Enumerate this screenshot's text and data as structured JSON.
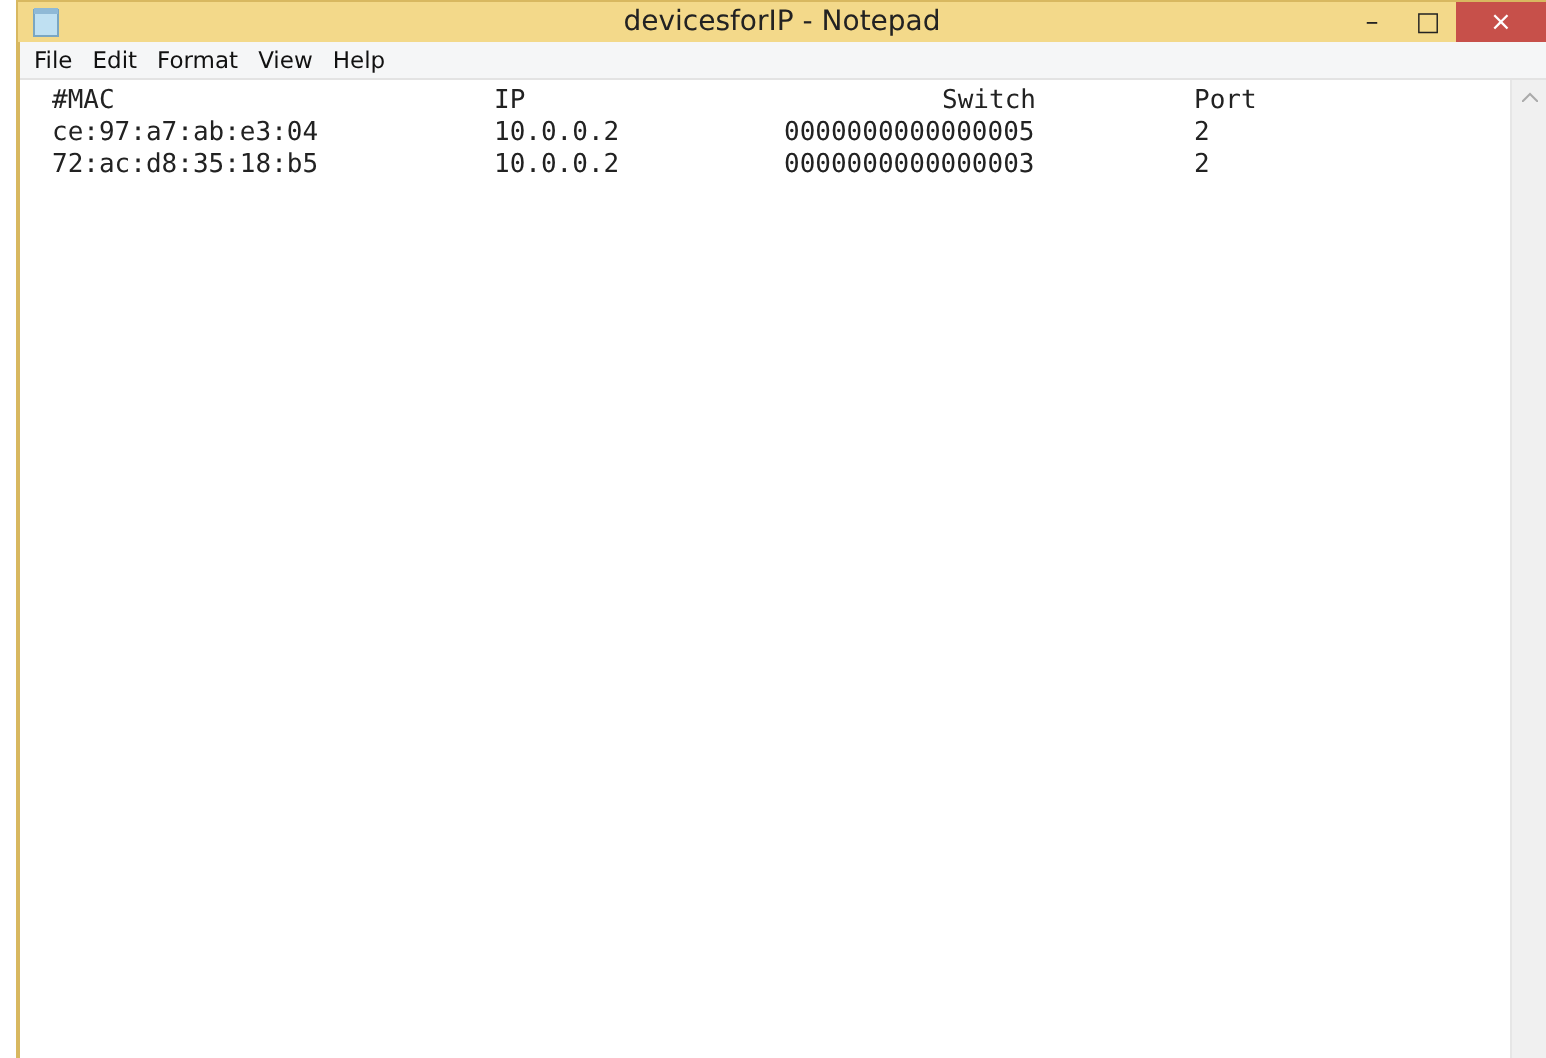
{
  "window": {
    "title": "devicesforIP - Notepad",
    "controls": [
      "–",
      "□",
      "×"
    ]
  },
  "menu": [
    {
      "label": "File"
    },
    {
      "label": "Edit"
    },
    {
      "label": "Format"
    },
    {
      "label": "View"
    },
    {
      "label": "Help"
    }
  ],
  "document": {
    "header": [
      "#MAC",
      "IP",
      "Switch",
      "Port"
    ],
    "rows": [
      [
        "ce:97:a7:ab:e3:04",
        "10.0.0.2",
        "0000000000000005",
        "2"
      ],
      [
        "72:ac:d8:35:18:b5",
        "10.0.0.2",
        "0000000000000003",
        "2"
      ]
    ]
  }
}
